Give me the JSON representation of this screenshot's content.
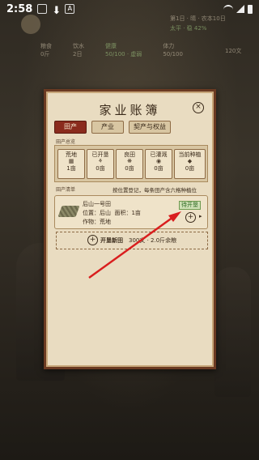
{
  "status_bar": {
    "time": "2:58"
  },
  "hud": {
    "line1_right": "第1日 · 晴 · 农本10日",
    "line2_right": "太平 · 稳 42%",
    "stats": [
      {
        "label": "粮食",
        "value": "0斤"
      },
      {
        "label": "饮水",
        "value": "2日"
      },
      {
        "label": "健康",
        "value": "50/100 · 虚弱"
      },
      {
        "label": "体力",
        "value": "50/100"
      }
    ],
    "coin": "120文"
  },
  "dialog": {
    "title": "家业账簿",
    "close_glyph": "×",
    "tabs": [
      "田产",
      "产业",
      "契产与权益"
    ],
    "overview_label": "田产总览",
    "overview": [
      {
        "label": "荒地",
        "icon": "▦",
        "value": "1亩"
      },
      {
        "label": "已开垦",
        "icon": "⚘",
        "value": "0亩"
      },
      {
        "label": "良田",
        "icon": "❋",
        "value": "0亩"
      },
      {
        "label": "已灌溉",
        "icon": "◉",
        "value": "0亩"
      },
      {
        "label": "当前种植",
        "icon": "◆",
        "value": "0亩"
      }
    ],
    "list_label": "田产清单",
    "hint": "按位置登记，每条田产含六格种植位",
    "plot": {
      "name": "后山一号田",
      "location": "位置：后山",
      "area": "面积：1亩",
      "crop": "作物：荒地",
      "badge": "待开垦",
      "add_glyph": "+",
      "arrow_glyph": "▸"
    },
    "new_land": {
      "plus_glyph": "+",
      "label": "开垦新田",
      "cost": "300文 · 2.0斤余粮"
    }
  },
  "colors": {
    "accent_red": "#8a2b1d",
    "annotation_arrow": "#d91e1e",
    "paper": "#e9dcc1"
  }
}
